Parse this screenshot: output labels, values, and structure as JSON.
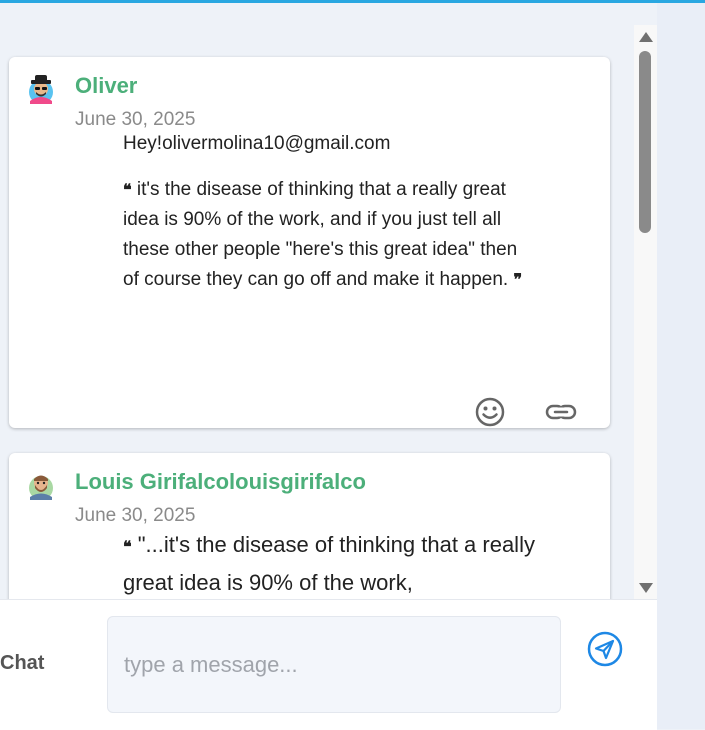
{
  "messages": [
    {
      "author": "Oliver",
      "date": "June 30, 2025",
      "email_line": "Hey!olivermolina10@gmail.com",
      "quote": "it's the disease of thinking that a really great idea is 90% of the work, and if you just tell all these other people \"here's this great idea\" then of course they can go off and make it happen.",
      "open_quote": "❝",
      "close_quote": "❞",
      "actions": [
        "emoji-icon",
        "link-icon"
      ]
    },
    {
      "author": "Louis Girifalcolouisgirifalco",
      "date": "June 30, 2025",
      "quote": "\"...it's the disease of thinking that a really great idea is 90% of the work,",
      "open_quote": "❝"
    }
  ],
  "composer": {
    "label": "Chat",
    "placeholder": "type a message...",
    "send_icon": "send-icon"
  },
  "colors": {
    "author": "#4caf7a",
    "accent": "#1e88e5",
    "top_bar": "#29a7e1"
  }
}
